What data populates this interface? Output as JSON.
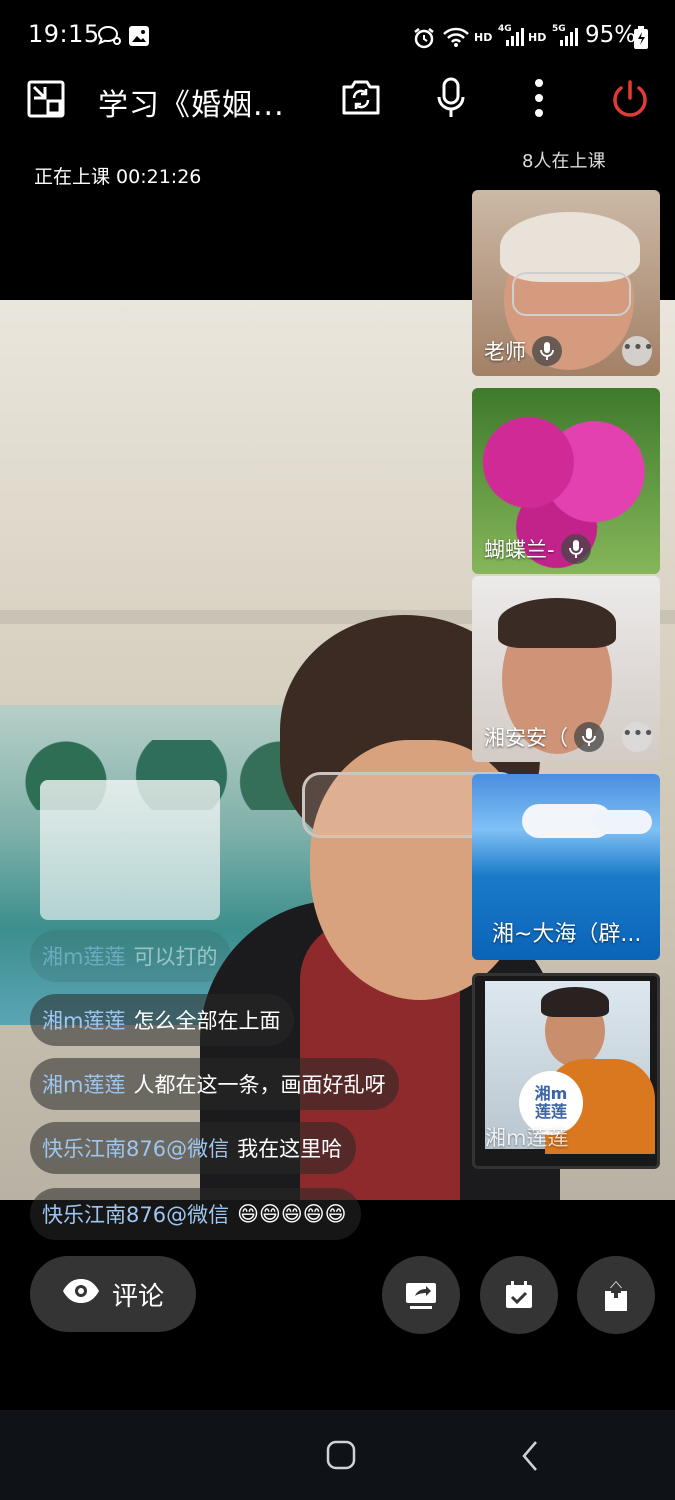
{
  "status_bar": {
    "time": "19:15",
    "battery": "95%",
    "indicators": [
      "HD",
      "4G",
      "HD",
      "5G"
    ]
  },
  "header": {
    "title": "学习《婚姻...",
    "class_status": "正在上课 00:21:26",
    "participant_count": "8人在上课"
  },
  "participants": [
    {
      "name": "老师",
      "has_more": true
    },
    {
      "name": "蝴蝶兰-",
      "has_more": false
    },
    {
      "name": "湘安安（",
      "has_more": true
    },
    {
      "name": "湘~大海（辟...",
      "has_more": false
    },
    {
      "name": "湘m莲莲",
      "has_more": false
    }
  ],
  "avatar_badge": "湘m\n莲莲",
  "chat": [
    {
      "name": "湘m莲莲",
      "text": "可以打的"
    },
    {
      "name": "湘m莲莲",
      "text": "怎么全部在上面"
    },
    {
      "name": "湘m莲莲",
      "text": "人都在这一条，画面好乱呀"
    },
    {
      "name": "快乐江南876@微信",
      "text": "我在这里哈"
    },
    {
      "name": "快乐江南876@微信",
      "text": "😄😄😄😄😄"
    }
  ],
  "controls": {
    "comment_label": "评论"
  },
  "icons": {
    "exit_color": "#e53935"
  }
}
